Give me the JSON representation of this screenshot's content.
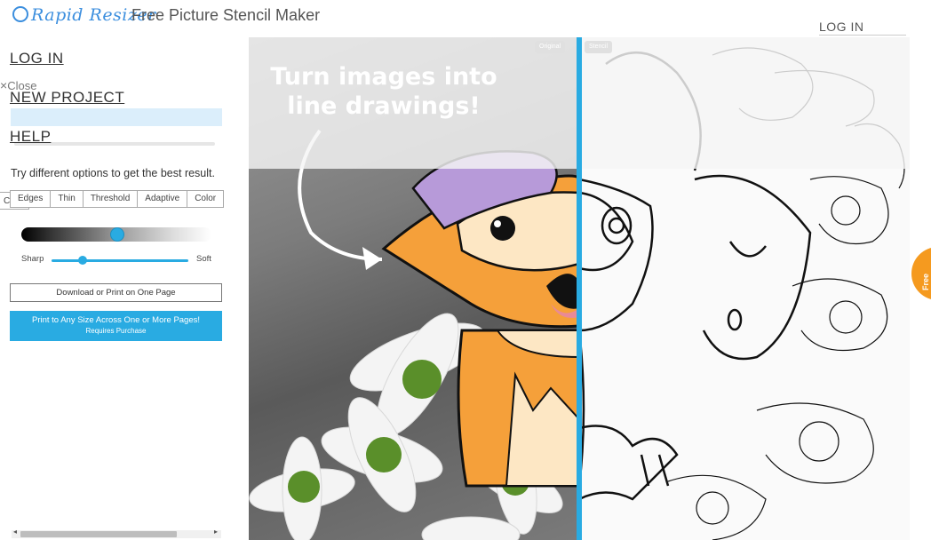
{
  "header": {
    "logo_text": "Rapid Resizer",
    "title": "Free Picture Stencil Maker",
    "login": "LOG IN"
  },
  "sidebar": {
    "menu": [
      {
        "label": "LOG IN"
      },
      {
        "label": "NEW PROJECT"
      },
      {
        "label": "HELP"
      }
    ],
    "close_label": "Close",
    "hint": "Try different options to get the best result.",
    "cl_tab": "Cl",
    "tabs": [
      "Edges",
      "Thin",
      "Threshold",
      "Adaptive",
      "Color"
    ],
    "sharp_label": "Sharp",
    "soft_label": "Soft",
    "download_label": "Download or Print on One Page",
    "print_label": "Print to Any Size Across One or More Pages!",
    "print_sub": "Requires Purchase",
    "blur_level": 0.23,
    "gradient_level": 0.5
  },
  "main": {
    "headline_1": "Turn images into",
    "headline_2": "line drawings!",
    "badge_left": "Original",
    "badge_right": "Stencil",
    "free_tools": "Free Tools"
  },
  "colors": {
    "accent": "#29abe2",
    "free_tools": "#f59a1f",
    "fox_orange": "#f5a03a",
    "hat": "#b79ad9"
  }
}
